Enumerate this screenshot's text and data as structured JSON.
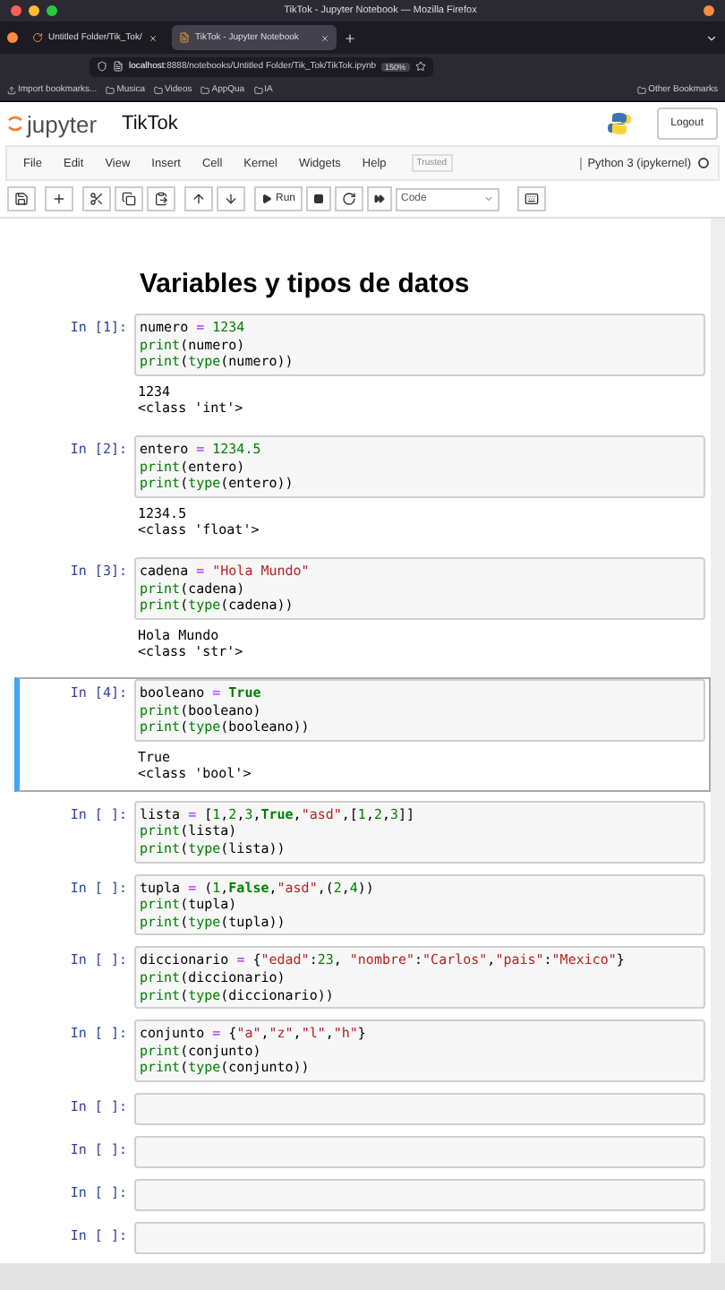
{
  "browser": {
    "window_title": "TikTok - Jupyter Notebook — Mozilla Firefox",
    "tabs": [
      {
        "label": "Untitled Folder/Tik_Tok/",
        "selected": false,
        "kind": "loading"
      },
      {
        "label": "TikTok - Jupyter Notebook",
        "selected": true,
        "kind": "notebook"
      }
    ],
    "url": {
      "host": "localhost",
      "path": ":8888/notebooks/Untitled Folder/Tik_Tok/TikTok.ipynb"
    },
    "zoom": "150%",
    "bookmarks": [
      {
        "label": "Import bookmarks...",
        "kind": "import"
      },
      {
        "label": "Musica",
        "kind": "folder"
      },
      {
        "label": "Videos",
        "kind": "folder"
      },
      {
        "label": "AppQua",
        "kind": "folder"
      },
      {
        "label": "IA",
        "kind": "folder"
      }
    ],
    "other_bookmarks": "Other Bookmarks"
  },
  "jupyter": {
    "logo_text": "jupyter",
    "notebook_title": "TikTok",
    "logout": "Logout",
    "menu": [
      "File",
      "Edit",
      "View",
      "Insert",
      "Cell",
      "Kernel",
      "Widgets",
      "Help"
    ],
    "trusted": "Trusted",
    "kernel": "Python 3 (ipykernel)",
    "run": "Run",
    "cell_type": "Code"
  },
  "notebook": {
    "heading": "Variables y tipos de datos",
    "cells": [
      {
        "prompt": "In [1]:",
        "selected": false,
        "lines": [
          [
            {
              "t": "numero ",
              "kind": "name"
            },
            {
              "t": "=",
              "kind": "op"
            },
            {
              "t": " 1234",
              "kind": "num"
            }
          ],
          [
            {
              "t": "print",
              "kind": "builtin"
            },
            {
              "t": "(numero)",
              "kind": "name"
            }
          ],
          [
            {
              "t": "print",
              "kind": "builtin"
            },
            {
              "t": "(",
              "kind": "name"
            },
            {
              "t": "type",
              "kind": "builtin"
            },
            {
              "t": "(numero))",
              "kind": "name"
            }
          ]
        ],
        "output": [
          "1234",
          "<class 'int'>"
        ]
      },
      {
        "prompt": "In [2]:",
        "selected": false,
        "lines": [
          [
            {
              "t": "entero ",
              "kind": "name"
            },
            {
              "t": "=",
              "kind": "op"
            },
            {
              "t": " 1234.5",
              "kind": "num"
            }
          ],
          [
            {
              "t": "print",
              "kind": "builtin"
            },
            {
              "t": "(entero)",
              "kind": "name"
            }
          ],
          [
            {
              "t": "print",
              "kind": "builtin"
            },
            {
              "t": "(",
              "kind": "name"
            },
            {
              "t": "type",
              "kind": "builtin"
            },
            {
              "t": "(entero))",
              "kind": "name"
            }
          ]
        ],
        "output": [
          "1234.5",
          "<class 'float'>"
        ]
      },
      {
        "prompt": "In [3]:",
        "selected": false,
        "lines": [
          [
            {
              "t": "cadena ",
              "kind": "name"
            },
            {
              "t": "=",
              "kind": "op"
            },
            {
              "t": " \"Hola Mundo\"",
              "kind": "str"
            }
          ],
          [
            {
              "t": "print",
              "kind": "builtin"
            },
            {
              "t": "(cadena)",
              "kind": "name"
            }
          ],
          [
            {
              "t": "print",
              "kind": "builtin"
            },
            {
              "t": "(",
              "kind": "name"
            },
            {
              "t": "type",
              "kind": "builtin"
            },
            {
              "t": "(cadena))",
              "kind": "name"
            }
          ]
        ],
        "output": [
          "Hola Mundo",
          "<class 'str'>"
        ]
      },
      {
        "prompt": "In [4]:",
        "selected": true,
        "lines": [
          [
            {
              "t": "booleano ",
              "kind": "name"
            },
            {
              "t": "=",
              "kind": "op"
            },
            {
              "t": " True",
              "kind": "kw"
            }
          ],
          [
            {
              "t": "print",
              "kind": "builtin"
            },
            {
              "t": "(booleano)",
              "kind": "name"
            }
          ],
          [
            {
              "t": "print",
              "kind": "builtin"
            },
            {
              "t": "(",
              "kind": "name"
            },
            {
              "t": "type",
              "kind": "builtin"
            },
            {
              "t": "(booleano))",
              "kind": "name"
            }
          ]
        ],
        "output": [
          "True",
          "<class 'bool'>"
        ]
      },
      {
        "prompt": "In [ ]:",
        "selected": false,
        "lines": [
          [
            {
              "t": "lista ",
              "kind": "name"
            },
            {
              "t": "=",
              "kind": "op"
            },
            {
              "t": " [",
              "kind": "name"
            },
            {
              "t": "1",
              "kind": "num"
            },
            {
              "t": ",",
              "kind": "name"
            },
            {
              "t": "2",
              "kind": "num"
            },
            {
              "t": ",",
              "kind": "name"
            },
            {
              "t": "3",
              "kind": "num"
            },
            {
              "t": ",",
              "kind": "name"
            },
            {
              "t": "True",
              "kind": "kw"
            },
            {
              "t": ",",
              "kind": "name"
            },
            {
              "t": "\"asd\"",
              "kind": "str"
            },
            {
              "t": ",[",
              "kind": "name"
            },
            {
              "t": "1",
              "kind": "num"
            },
            {
              "t": ",",
              "kind": "name"
            },
            {
              "t": "2",
              "kind": "num"
            },
            {
              "t": ",",
              "kind": "name"
            },
            {
              "t": "3",
              "kind": "num"
            },
            {
              "t": "]]",
              "kind": "name"
            }
          ],
          [
            {
              "t": "print",
              "kind": "builtin"
            },
            {
              "t": "(lista)",
              "kind": "name"
            }
          ],
          [
            {
              "t": "print",
              "kind": "builtin"
            },
            {
              "t": "(",
              "kind": "name"
            },
            {
              "t": "type",
              "kind": "builtin"
            },
            {
              "t": "(lista))",
              "kind": "name"
            }
          ]
        ]
      },
      {
        "prompt": "In [ ]:",
        "selected": false,
        "lines": [
          [
            {
              "t": "tupla ",
              "kind": "name"
            },
            {
              "t": "=",
              "kind": "op"
            },
            {
              "t": " (",
              "kind": "name"
            },
            {
              "t": "1",
              "kind": "num"
            },
            {
              "t": ",",
              "kind": "name"
            },
            {
              "t": "False",
              "kind": "kw"
            },
            {
              "t": ",",
              "kind": "name"
            },
            {
              "t": "\"asd\"",
              "kind": "str"
            },
            {
              "t": ",(",
              "kind": "name"
            },
            {
              "t": "2",
              "kind": "num"
            },
            {
              "t": ",",
              "kind": "name"
            },
            {
              "t": "4",
              "kind": "num"
            },
            {
              "t": "))",
              "kind": "name"
            }
          ],
          [
            {
              "t": "print",
              "kind": "builtin"
            },
            {
              "t": "(tupla)",
              "kind": "name"
            }
          ],
          [
            {
              "t": "print",
              "kind": "builtin"
            },
            {
              "t": "(",
              "kind": "name"
            },
            {
              "t": "type",
              "kind": "builtin"
            },
            {
              "t": "(tupla))",
              "kind": "name"
            }
          ]
        ]
      },
      {
        "prompt": "In [ ]:",
        "selected": false,
        "lines": [
          [
            {
              "t": "diccionario ",
              "kind": "name"
            },
            {
              "t": "=",
              "kind": "op"
            },
            {
              "t": " {",
              "kind": "name"
            },
            {
              "t": "\"edad\"",
              "kind": "str"
            },
            {
              "t": ":",
              "kind": "name"
            },
            {
              "t": "23",
              "kind": "num"
            },
            {
              "t": ", ",
              "kind": "name"
            },
            {
              "t": "\"nombre\"",
              "kind": "str"
            },
            {
              "t": ":",
              "kind": "name"
            },
            {
              "t": "\"Carlos\"",
              "kind": "str"
            },
            {
              "t": ",",
              "kind": "name"
            },
            {
              "t": "\"pais\"",
              "kind": "str"
            },
            {
              "t": ":",
              "kind": "name"
            },
            {
              "t": "\"Mexico\"",
              "kind": "str"
            },
            {
              "t": "}",
              "kind": "name"
            }
          ],
          [
            {
              "t": "print",
              "kind": "builtin"
            },
            {
              "t": "(diccionario)",
              "kind": "name"
            }
          ],
          [
            {
              "t": "print",
              "kind": "builtin"
            },
            {
              "t": "(",
              "kind": "name"
            },
            {
              "t": "type",
              "kind": "builtin"
            },
            {
              "t": "(diccionario))",
              "kind": "name"
            }
          ]
        ]
      },
      {
        "prompt": "In [ ]:",
        "selected": false,
        "lines": [
          [
            {
              "t": "conjunto ",
              "kind": "name"
            },
            {
              "t": "=",
              "kind": "op"
            },
            {
              "t": " {",
              "kind": "name"
            },
            {
              "t": "\"a\"",
              "kind": "str"
            },
            {
              "t": ",",
              "kind": "name"
            },
            {
              "t": "\"z\"",
              "kind": "str"
            },
            {
              "t": ",",
              "kind": "name"
            },
            {
              "t": "\"l\"",
              "kind": "str"
            },
            {
              "t": ",",
              "kind": "name"
            },
            {
              "t": "\"h\"",
              "kind": "str"
            },
            {
              "t": "}",
              "kind": "name"
            }
          ],
          [
            {
              "t": "print",
              "kind": "builtin"
            },
            {
              "t": "(conjunto)",
              "kind": "name"
            }
          ],
          [
            {
              "t": "print",
              "kind": "builtin"
            },
            {
              "t": "(",
              "kind": "name"
            },
            {
              "t": "type",
              "kind": "builtin"
            },
            {
              "t": "(conjunto))",
              "kind": "name"
            }
          ]
        ]
      },
      {
        "prompt": "In [ ]:",
        "selected": false
      },
      {
        "prompt": "In [ ]:",
        "selected": false
      },
      {
        "prompt": "In [ ]:",
        "selected": false
      },
      {
        "prompt": "In [ ]:",
        "selected": false
      }
    ]
  }
}
